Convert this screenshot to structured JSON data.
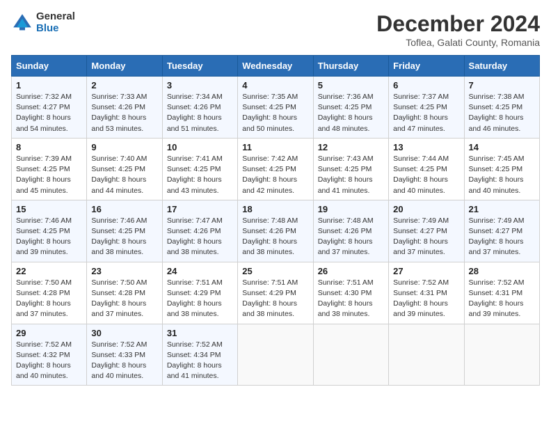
{
  "logo": {
    "general": "General",
    "blue": "Blue"
  },
  "title": "December 2024",
  "subtitle": "Toflea, Galati County, Romania",
  "days_header": [
    "Sunday",
    "Monday",
    "Tuesday",
    "Wednesday",
    "Thursday",
    "Friday",
    "Saturday"
  ],
  "weeks": [
    [
      {
        "day": "1",
        "sunrise": "Sunrise: 7:32 AM",
        "sunset": "Sunset: 4:27 PM",
        "daylight": "Daylight: 8 hours and 54 minutes."
      },
      {
        "day": "2",
        "sunrise": "Sunrise: 7:33 AM",
        "sunset": "Sunset: 4:26 PM",
        "daylight": "Daylight: 8 hours and 53 minutes."
      },
      {
        "day": "3",
        "sunrise": "Sunrise: 7:34 AM",
        "sunset": "Sunset: 4:26 PM",
        "daylight": "Daylight: 8 hours and 51 minutes."
      },
      {
        "day": "4",
        "sunrise": "Sunrise: 7:35 AM",
        "sunset": "Sunset: 4:25 PM",
        "daylight": "Daylight: 8 hours and 50 minutes."
      },
      {
        "day": "5",
        "sunrise": "Sunrise: 7:36 AM",
        "sunset": "Sunset: 4:25 PM",
        "daylight": "Daylight: 8 hours and 48 minutes."
      },
      {
        "day": "6",
        "sunrise": "Sunrise: 7:37 AM",
        "sunset": "Sunset: 4:25 PM",
        "daylight": "Daylight: 8 hours and 47 minutes."
      },
      {
        "day": "7",
        "sunrise": "Sunrise: 7:38 AM",
        "sunset": "Sunset: 4:25 PM",
        "daylight": "Daylight: 8 hours and 46 minutes."
      }
    ],
    [
      {
        "day": "8",
        "sunrise": "Sunrise: 7:39 AM",
        "sunset": "Sunset: 4:25 PM",
        "daylight": "Daylight: 8 hours and 45 minutes."
      },
      {
        "day": "9",
        "sunrise": "Sunrise: 7:40 AM",
        "sunset": "Sunset: 4:25 PM",
        "daylight": "Daylight: 8 hours and 44 minutes."
      },
      {
        "day": "10",
        "sunrise": "Sunrise: 7:41 AM",
        "sunset": "Sunset: 4:25 PM",
        "daylight": "Daylight: 8 hours and 43 minutes."
      },
      {
        "day": "11",
        "sunrise": "Sunrise: 7:42 AM",
        "sunset": "Sunset: 4:25 PM",
        "daylight": "Daylight: 8 hours and 42 minutes."
      },
      {
        "day": "12",
        "sunrise": "Sunrise: 7:43 AM",
        "sunset": "Sunset: 4:25 PM",
        "daylight": "Daylight: 8 hours and 41 minutes."
      },
      {
        "day": "13",
        "sunrise": "Sunrise: 7:44 AM",
        "sunset": "Sunset: 4:25 PM",
        "daylight": "Daylight: 8 hours and 40 minutes."
      },
      {
        "day": "14",
        "sunrise": "Sunrise: 7:45 AM",
        "sunset": "Sunset: 4:25 PM",
        "daylight": "Daylight: 8 hours and 40 minutes."
      }
    ],
    [
      {
        "day": "15",
        "sunrise": "Sunrise: 7:46 AM",
        "sunset": "Sunset: 4:25 PM",
        "daylight": "Daylight: 8 hours and 39 minutes."
      },
      {
        "day": "16",
        "sunrise": "Sunrise: 7:46 AM",
        "sunset": "Sunset: 4:25 PM",
        "daylight": "Daylight: 8 hours and 38 minutes."
      },
      {
        "day": "17",
        "sunrise": "Sunrise: 7:47 AM",
        "sunset": "Sunset: 4:26 PM",
        "daylight": "Daylight: 8 hours and 38 minutes."
      },
      {
        "day": "18",
        "sunrise": "Sunrise: 7:48 AM",
        "sunset": "Sunset: 4:26 PM",
        "daylight": "Daylight: 8 hours and 38 minutes."
      },
      {
        "day": "19",
        "sunrise": "Sunrise: 7:48 AM",
        "sunset": "Sunset: 4:26 PM",
        "daylight": "Daylight: 8 hours and 37 minutes."
      },
      {
        "day": "20",
        "sunrise": "Sunrise: 7:49 AM",
        "sunset": "Sunset: 4:27 PM",
        "daylight": "Daylight: 8 hours and 37 minutes."
      },
      {
        "day": "21",
        "sunrise": "Sunrise: 7:49 AM",
        "sunset": "Sunset: 4:27 PM",
        "daylight": "Daylight: 8 hours and 37 minutes."
      }
    ],
    [
      {
        "day": "22",
        "sunrise": "Sunrise: 7:50 AM",
        "sunset": "Sunset: 4:28 PM",
        "daylight": "Daylight: 8 hours and 37 minutes."
      },
      {
        "day": "23",
        "sunrise": "Sunrise: 7:50 AM",
        "sunset": "Sunset: 4:28 PM",
        "daylight": "Daylight: 8 hours and 37 minutes."
      },
      {
        "day": "24",
        "sunrise": "Sunrise: 7:51 AM",
        "sunset": "Sunset: 4:29 PM",
        "daylight": "Daylight: 8 hours and 38 minutes."
      },
      {
        "day": "25",
        "sunrise": "Sunrise: 7:51 AM",
        "sunset": "Sunset: 4:29 PM",
        "daylight": "Daylight: 8 hours and 38 minutes."
      },
      {
        "day": "26",
        "sunrise": "Sunrise: 7:51 AM",
        "sunset": "Sunset: 4:30 PM",
        "daylight": "Daylight: 8 hours and 38 minutes."
      },
      {
        "day": "27",
        "sunrise": "Sunrise: 7:52 AM",
        "sunset": "Sunset: 4:31 PM",
        "daylight": "Daylight: 8 hours and 39 minutes."
      },
      {
        "day": "28",
        "sunrise": "Sunrise: 7:52 AM",
        "sunset": "Sunset: 4:31 PM",
        "daylight": "Daylight: 8 hours and 39 minutes."
      }
    ],
    [
      {
        "day": "29",
        "sunrise": "Sunrise: 7:52 AM",
        "sunset": "Sunset: 4:32 PM",
        "daylight": "Daylight: 8 hours and 40 minutes."
      },
      {
        "day": "30",
        "sunrise": "Sunrise: 7:52 AM",
        "sunset": "Sunset: 4:33 PM",
        "daylight": "Daylight: 8 hours and 40 minutes."
      },
      {
        "day": "31",
        "sunrise": "Sunrise: 7:52 AM",
        "sunset": "Sunset: 4:34 PM",
        "daylight": "Daylight: 8 hours and 41 minutes."
      },
      null,
      null,
      null,
      null
    ]
  ]
}
